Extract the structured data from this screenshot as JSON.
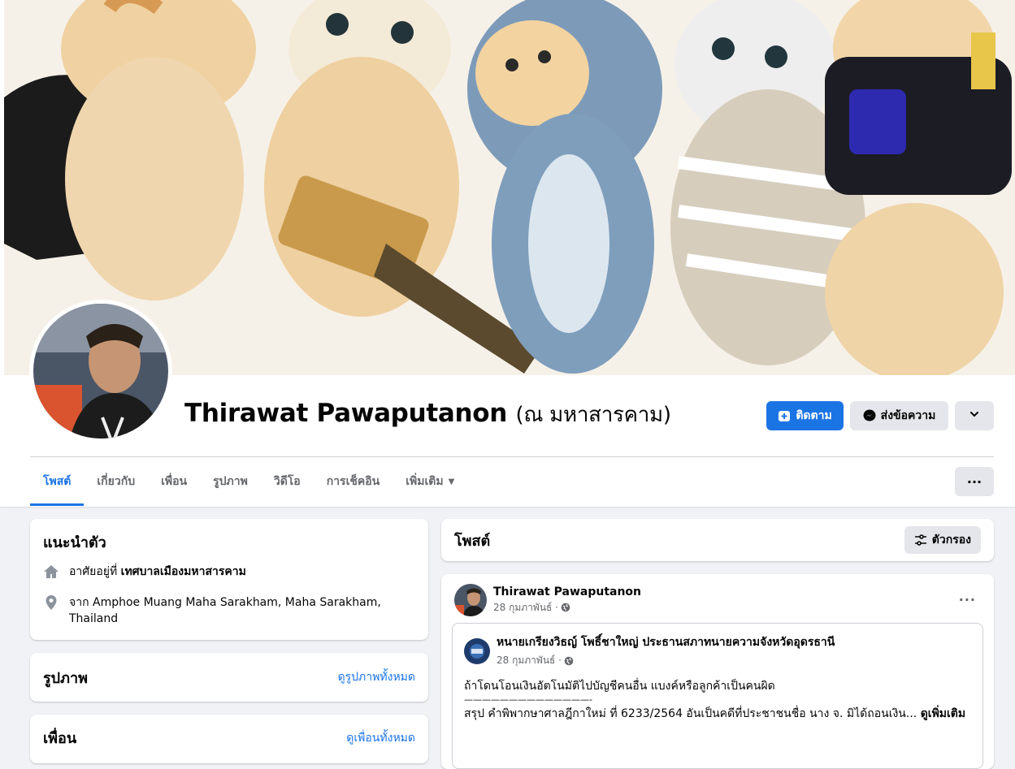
{
  "profile": {
    "name": "Thirawat Pawaputanon",
    "alternate_name": "(ณ มหาสารคาม)"
  },
  "actions": {
    "follow_label": "ติดตาม",
    "message_label": "ส่งข้อความ"
  },
  "tabs": [
    {
      "label": "โพสต์",
      "active": true
    },
    {
      "label": "เกี่ยวกับ"
    },
    {
      "label": "เพื่อน"
    },
    {
      "label": "รูปภาพ"
    },
    {
      "label": "วิดีโอ"
    },
    {
      "label": "การเช็คอิน"
    },
    {
      "label": "เพิ่มเติม"
    }
  ],
  "intro": {
    "title": "แนะนำตัว",
    "lives_prefix": "อาศัยอยู่ที่",
    "lives_place": "เทศบาลเมืองมหาสารคาม",
    "from_prefix": "จาก",
    "from_place": "Amphoe Muang Maha Sarakham, Maha Sarakham, Thailand"
  },
  "photos": {
    "title": "รูปภาพ",
    "see_all": "ดูรูปภาพทั้งหมด"
  },
  "friends": {
    "title": "เพื่อน",
    "see_all": "ดูเพื่อนทั้งหมด"
  },
  "posts_header": {
    "title": "โพสต์",
    "filter_label": "ตัวกรอง"
  },
  "post": {
    "author": "Thirawat Pawaputanon",
    "date": "28 กุมภาพันธ์ ·",
    "shared": {
      "author": "หนายเกรียงวิธญ์ โพธิ์ชาใหญ่ ประธานสภาทนายความจังหวัดอุดรธานี",
      "date": "28 กุมภาพันธ์ ·",
      "line1": "ถ้าโดนโอนเงินอัตโนมัติไปบัญชีคนอื่น แบงค์หรือลูกค้าเป็นคนผิด",
      "line2": "——————————————-",
      "line3": "สรุป คำพิพากษาศาลฎีกาใหม่ ที่ 6233/2564 อันเป็นคดีที่ประชาชนชื่อ นาง จ. มิได้ถอนเงิน...",
      "see_more": "ดูเพิ่มเติม"
    }
  },
  "colors": {
    "accent": "#1b74e4",
    "page_bg": "#f0f2f5",
    "button_gray": "#e4e6eb"
  },
  "icons": [
    "home-icon",
    "location-pin-icon",
    "follow-plus-icon",
    "messenger-icon",
    "chevron-down-icon",
    "more-dots-icon",
    "filter-icon",
    "globe-icon"
  ]
}
